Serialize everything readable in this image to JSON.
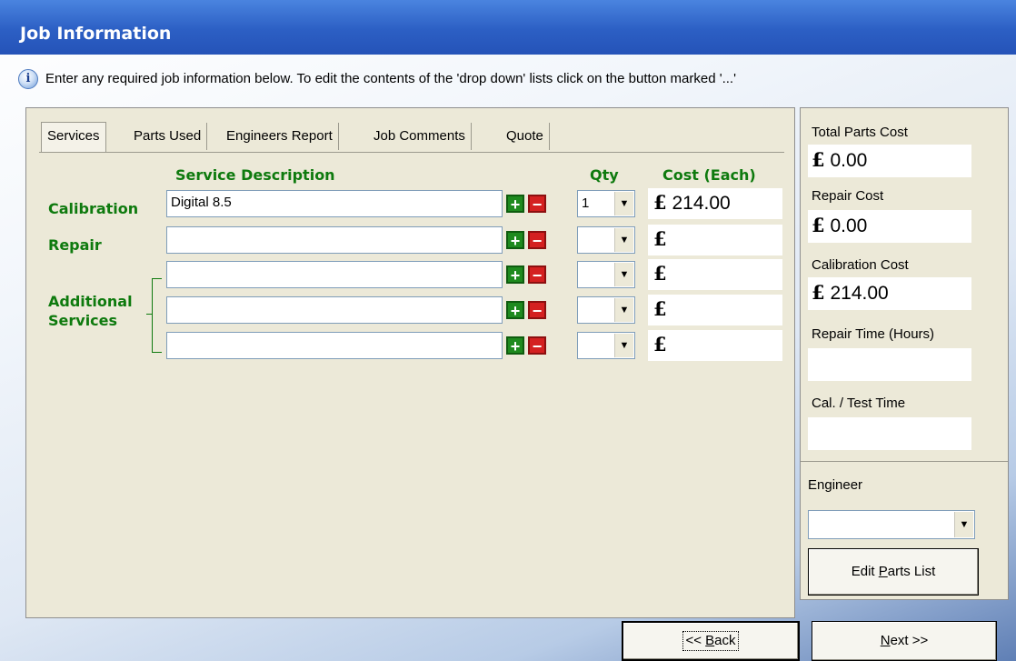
{
  "window": {
    "title": "Job Information"
  },
  "info": {
    "icon": "info-icon",
    "text": "Enter any required job information below. To edit the contents of the 'drop down' lists click on the button marked '...'"
  },
  "tabs": [
    {
      "label": "Services",
      "active": true
    },
    {
      "label": "Parts Used",
      "active": false
    },
    {
      "label": "Engineers Report",
      "active": false
    },
    {
      "label": "Job Comments",
      "active": false
    },
    {
      "label": "Quote",
      "active": false
    }
  ],
  "services": {
    "headers": {
      "description": "Service Description",
      "qty": "Qty",
      "cost": "Cost (Each)"
    },
    "labels": {
      "calibration": "Calibration",
      "repair": "Repair",
      "additional": "Additional\nServices"
    },
    "rows": [
      {
        "description": "Digital 8.5",
        "qty": "1",
        "currency": "£",
        "cost": "214.00"
      },
      {
        "description": "",
        "qty": "",
        "currency": "£",
        "cost": ""
      },
      {
        "description": "",
        "qty": "",
        "currency": "£",
        "cost": ""
      },
      {
        "description": "",
        "qty": "",
        "currency": "£",
        "cost": ""
      },
      {
        "description": "",
        "qty": "",
        "currency": "£",
        "cost": ""
      }
    ],
    "add_symbol": "+",
    "remove_symbol": "−"
  },
  "summary": {
    "currency": "£",
    "total_parts_label": "Total Parts Cost",
    "total_parts_value": "0.00",
    "repair_cost_label": "Repair Cost",
    "repair_cost_value": "0.00",
    "calibration_cost_label": "Calibration Cost",
    "calibration_cost_value": "214.00",
    "repair_time_label": "Repair Time (Hours)",
    "repair_time_value": "",
    "cal_test_label": "Cal. / Test Time",
    "cal_test_value": "",
    "engineer_label": "Engineer",
    "engineer_value": "",
    "edit_parts_prefix": "Edit ",
    "edit_parts_accel": "P",
    "edit_parts_suffix": "arts List"
  },
  "nav": {
    "back_prefix": "<< ",
    "back_accel": "B",
    "back_suffix": "ack",
    "next_accel": "N",
    "next_suffix": "ext >>"
  },
  "colors": {
    "titlebar": "#2c5fc4",
    "label_green": "#0e7a0e",
    "add": "#1e8a1e",
    "remove": "#d42020"
  }
}
